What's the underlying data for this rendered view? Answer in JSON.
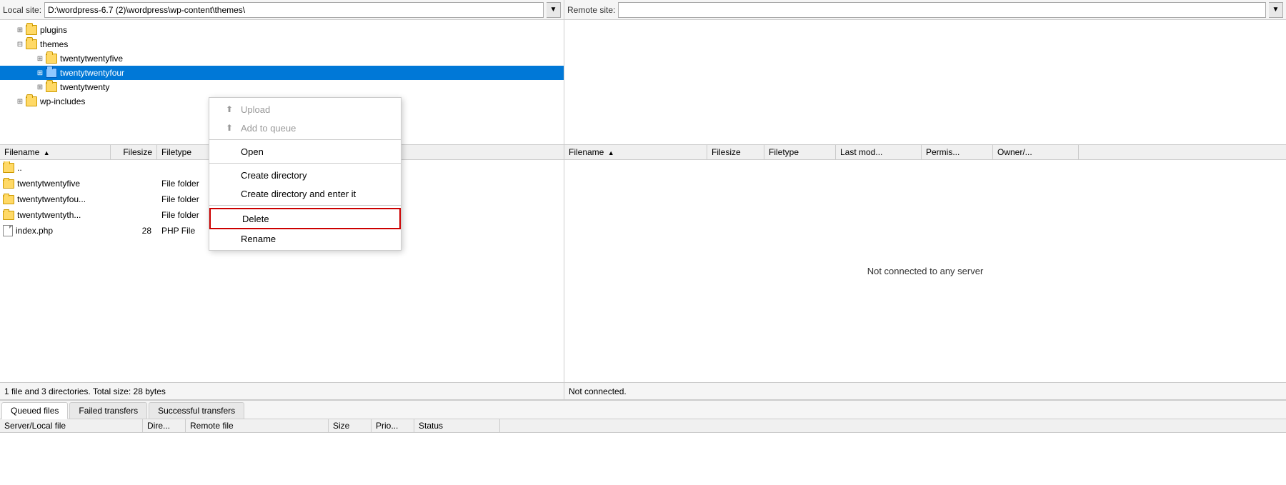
{
  "local_bar": {
    "label": "Local site:",
    "path": "D:\\wordpress-6.7 (2)\\wordpress\\wp-content\\themes\\"
  },
  "remote_bar": {
    "label": "Remote site:"
  },
  "tree": {
    "items": [
      {
        "id": "plugins",
        "label": "plugins",
        "indent": 1,
        "expanded": false,
        "selected": false
      },
      {
        "id": "themes",
        "label": "themes",
        "indent": 1,
        "expanded": true,
        "selected": false
      },
      {
        "id": "twentytwentyfive",
        "label": "twentytwentyfive",
        "indent": 2,
        "expanded": false,
        "selected": false
      },
      {
        "id": "twentytwentyfour",
        "label": "twentytwentyfour",
        "indent": 2,
        "expanded": false,
        "selected": true
      },
      {
        "id": "twentytwenty",
        "label": "twentytwenty",
        "indent": 2,
        "expanded": false,
        "selected": false
      },
      {
        "id": "wp-includes",
        "label": "wp-includes",
        "indent": 1,
        "expanded": false,
        "selected": false
      }
    ]
  },
  "file_list": {
    "headers": [
      {
        "id": "filename",
        "label": "Filename",
        "sort": "asc"
      },
      {
        "id": "filesize",
        "label": "Filesize"
      },
      {
        "id": "filetype",
        "label": "Filetype"
      }
    ],
    "rows": [
      {
        "name": "..",
        "size": "",
        "type": "",
        "icon": "parent"
      },
      {
        "name": "twentytwentyfive",
        "size": "",
        "type": "File folder",
        "icon": "folder"
      },
      {
        "name": "twentytwentyfou...",
        "size": "",
        "type": "File folder",
        "icon": "folder"
      },
      {
        "name": "twentytwentyth...",
        "size": "",
        "type": "File folder",
        "icon": "folder"
      },
      {
        "name": "index.php",
        "size": "28",
        "type": "PHP File",
        "icon": "file"
      }
    ]
  },
  "right_panel": {
    "headers": [
      {
        "id": "filename",
        "label": "Filename",
        "sort": "asc"
      },
      {
        "id": "filesize",
        "label": "Filesize"
      },
      {
        "id": "filetype",
        "label": "Filetype"
      },
      {
        "id": "lastmod",
        "label": "Last mod..."
      },
      {
        "id": "perms",
        "label": "Permis..."
      },
      {
        "id": "owner",
        "label": "Owner/..."
      }
    ],
    "not_connected_msg": "Not connected to any server"
  },
  "status_left": "1 file and 3 directories. Total size: 28 bytes",
  "status_right": "Not connected.",
  "context_menu": {
    "items": [
      {
        "id": "upload",
        "label": "Upload",
        "disabled": true,
        "icon": "upload"
      },
      {
        "id": "add-to-queue",
        "label": "Add to queue",
        "disabled": true,
        "icon": "add-queue"
      },
      {
        "id": "sep1",
        "type": "separator"
      },
      {
        "id": "open",
        "label": "Open",
        "disabled": false,
        "icon": ""
      },
      {
        "id": "sep2",
        "type": "separator"
      },
      {
        "id": "create-dir",
        "label": "Create directory",
        "disabled": false,
        "icon": ""
      },
      {
        "id": "create-dir-enter",
        "label": "Create directory and enter it",
        "disabled": false,
        "icon": ""
      },
      {
        "id": "sep3",
        "type": "separator"
      },
      {
        "id": "delete",
        "label": "Delete",
        "disabled": false,
        "icon": "",
        "highlight": true
      },
      {
        "id": "rename",
        "label": "Rename",
        "disabled": false,
        "icon": ""
      }
    ]
  },
  "queue_tabs": [
    {
      "id": "queued",
      "label": "Queued files",
      "active": true
    },
    {
      "id": "failed",
      "label": "Failed transfers",
      "active": false
    },
    {
      "id": "successful",
      "label": "Successful transfers",
      "active": false
    }
  ],
  "queue_headers": [
    {
      "id": "server",
      "label": "Server/Local file"
    },
    {
      "id": "dir",
      "label": "Dire..."
    },
    {
      "id": "remote",
      "label": "Remote file"
    },
    {
      "id": "size",
      "label": "Size"
    },
    {
      "id": "prio",
      "label": "Prio..."
    },
    {
      "id": "status",
      "label": "Status"
    }
  ],
  "icons": {
    "upload": "⬆",
    "add_queue": "⬆",
    "expand": "⊞",
    "collapse": "⊟",
    "arrow_down": "▼",
    "arrow_up": "▲"
  }
}
